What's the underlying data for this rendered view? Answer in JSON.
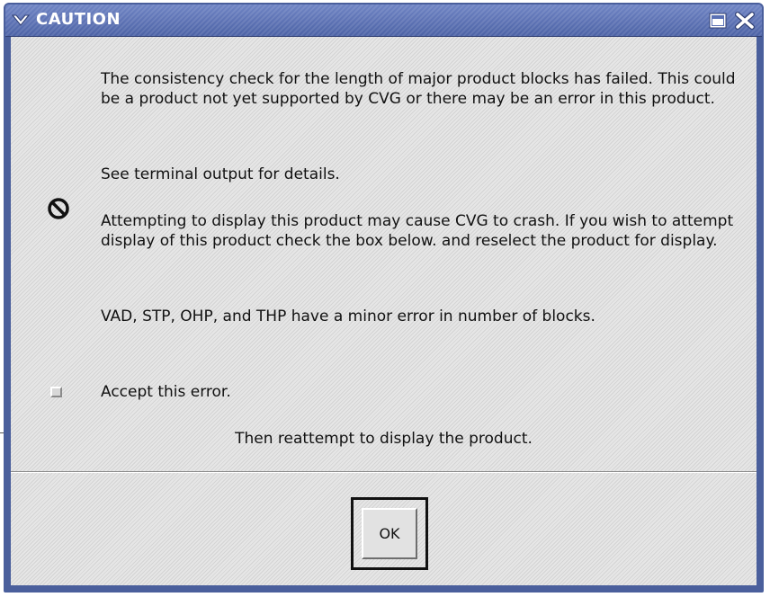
{
  "window": {
    "title": "CAUTION",
    "menu_icon": "chevron-down-icon",
    "maximize_icon": "maximize-icon",
    "close_icon": "close-icon"
  },
  "message": {
    "paragraph1": "The consistency check for the length of major product blocks has failed.  This could be a product not yet supported by CVG or there may be an error in this product.",
    "paragraph2": "See terminal output for details.",
    "paragraph3": "Attempting to display this product may cause CVG to crash.  If you wish to attempt display of this product check the box below. and reselect the product for display.",
    "paragraph4": "VAD, STP, OHP, and THP have a minor error in number of blocks.",
    "icon": "prohibited-icon"
  },
  "accept": {
    "label": "Accept this error.",
    "checked": false
  },
  "instruction": "Then reattempt to display the product.",
  "buttons": {
    "ok_label": "OK"
  },
  "colors": {
    "titlebar": "#5a70b4",
    "frame": "#4a5f9c",
    "client_bg": "#dcdcdc",
    "text": "#111111"
  }
}
